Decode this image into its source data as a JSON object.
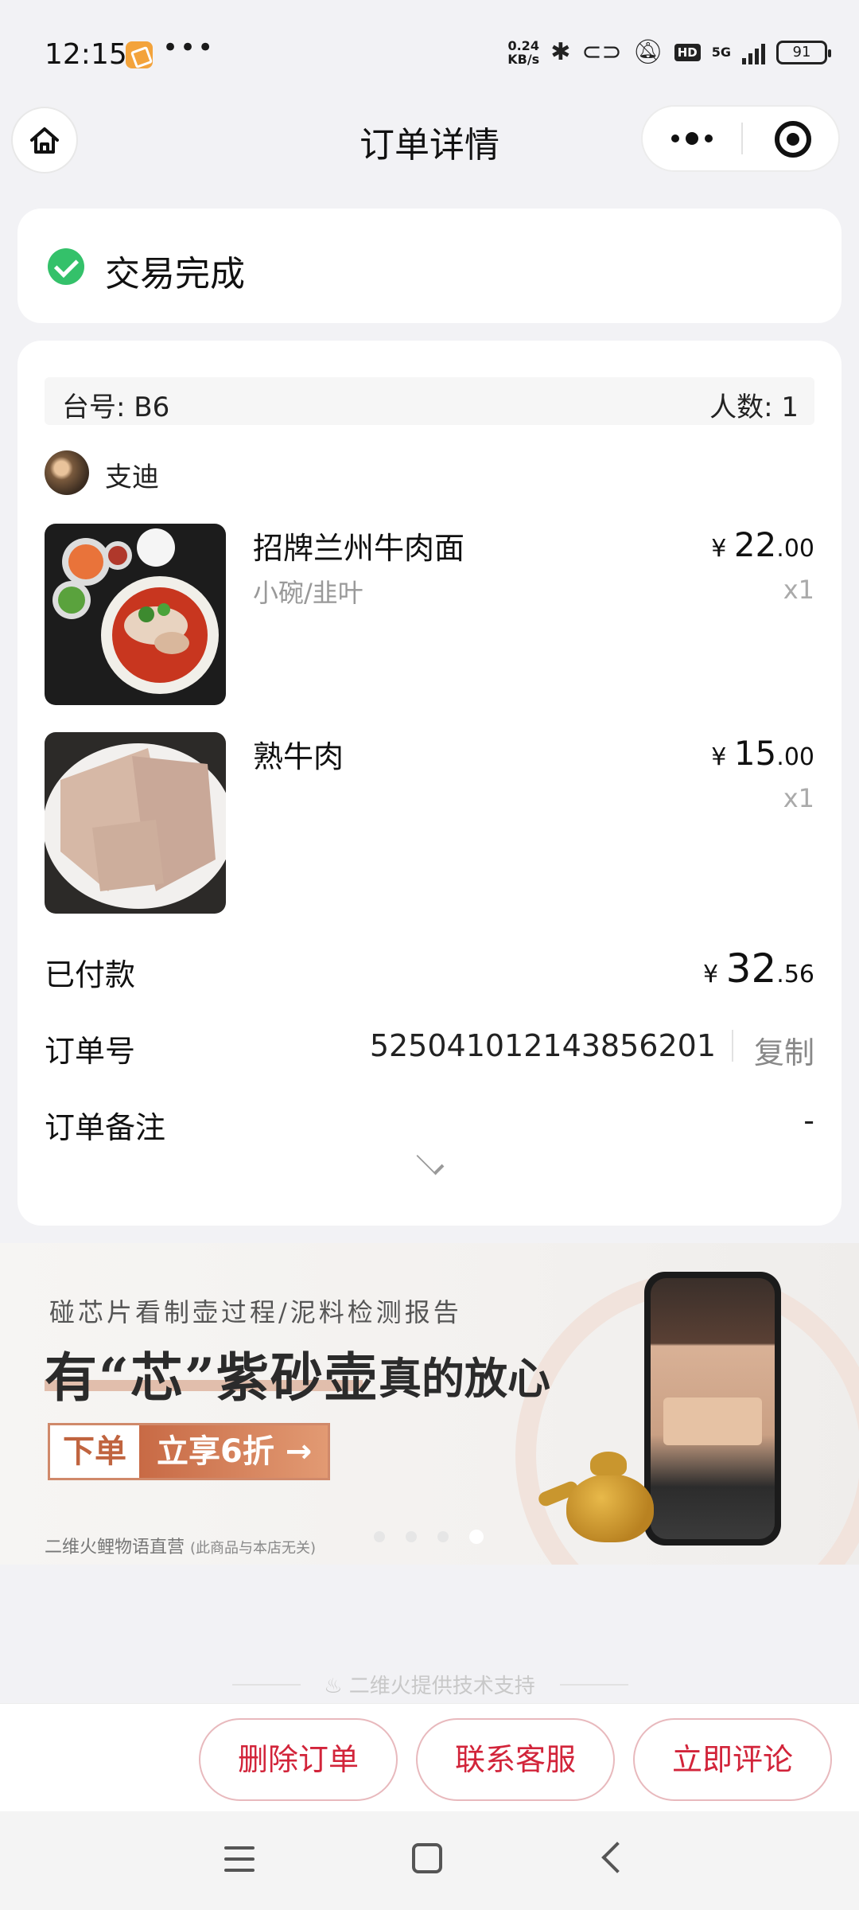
{
  "status_bar": {
    "time": "12:15",
    "dots": "•••",
    "net_speed_value": "0.24",
    "net_speed_unit": "KB/s",
    "network": "5G",
    "hd": "HD",
    "battery": "91",
    "icons": [
      "app-notification-icon",
      "bluetooth-icon",
      "link-icon",
      "bell-off-icon",
      "hd-icon",
      "signal-icon",
      "battery-icon"
    ]
  },
  "nav": {
    "title": "订单详情"
  },
  "order_status": {
    "text": "交易完成",
    "color": "#34c16a"
  },
  "order": {
    "table_label": "台号: B6",
    "people_label": "人数: 1",
    "user_name": "支迪",
    "items": [
      {
        "name": "招牌兰州牛肉面",
        "spec": "小碗/韭叶",
        "currency": "¥",
        "price_int": "22",
        "price_dec": ".00",
        "qty": "x1"
      },
      {
        "name": "熟牛肉",
        "spec": "",
        "currency": "¥",
        "price_int": "15",
        "price_dec": ".00",
        "qty": "x1"
      }
    ],
    "paid": {
      "label": "已付款",
      "currency": "¥",
      "amount_int": "32",
      "amount_dec": ".56"
    },
    "order_no": {
      "label": "订单号",
      "value": "525041012143856201",
      "copy_label": "复制"
    },
    "remark": {
      "label": "订单备注",
      "value": "-"
    }
  },
  "banner": {
    "subtitle": "碰芯片看制壶过程/泥料检测报告",
    "headline": "有“芯”紫砂壶",
    "headline2": "真的放心",
    "cta_left": "下单",
    "cta_right": "立享6折 →",
    "footer": "二维火鲤物语直营",
    "footer_note": "(此商品与本店无关)",
    "active_dot": 3,
    "dot_count": 4
  },
  "footer": {
    "tech_support": "二维火提供技术支持"
  },
  "actions": {
    "delete": "删除订单",
    "contact": "联系客服",
    "review": "立即评论",
    "accent": "#d2243a"
  }
}
